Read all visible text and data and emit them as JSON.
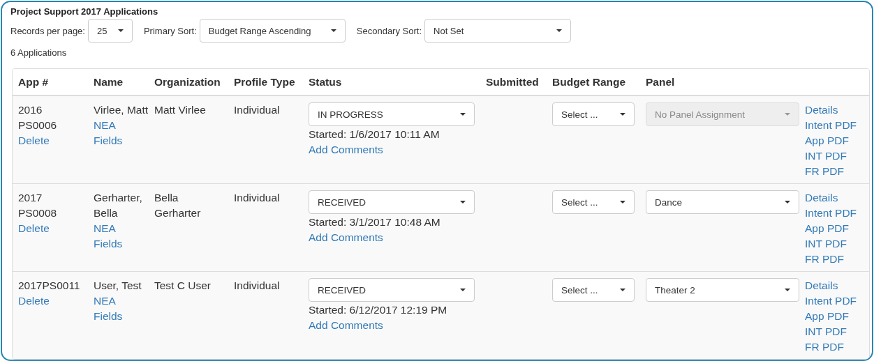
{
  "title": "Project Support 2017 Applications",
  "controls": [
    {
      "label": "Records per page:",
      "value": "25",
      "kind": "small"
    },
    {
      "label": "Primary Sort:",
      "value": "Budget Range Ascending",
      "kind": "medium"
    },
    {
      "label": "Secondary Sort:",
      "value": "Not Set",
      "kind": "large"
    }
  ],
  "count": "6 Applications",
  "table": {
    "columns": [
      "App #",
      "Name",
      "Organization",
      "Profile Type",
      "Status",
      "Submitted",
      "Budget Range",
      "Panel"
    ],
    "rows": [
      {
        "app_number": "2016 PS0006",
        "delete": "Delete",
        "name": "Virlee, Matt",
        "nea_fields": "NEA Fields",
        "organization": "Matt Virlee",
        "profile_type": "Individual",
        "status": "IN PROGRESS",
        "started": "Started: 1/6/2017 10:11 AM",
        "add_comments": "Add Comments",
        "budget_range": "Select ...",
        "panel": "No Panel Assignment",
        "panel_disabled": true,
        "links": [
          "Details",
          "Intent PDF",
          "App PDF",
          "INT PDF",
          "FR PDF"
        ]
      },
      {
        "app_number": "2017 PS0008",
        "delete": "Delete",
        "name": "Gerharter, Bella",
        "nea_fields": "NEA Fields",
        "organization": "Bella Gerharter",
        "profile_type": "Individual",
        "status": "RECEIVED",
        "started": "Started: 3/1/2017 10:48 AM",
        "add_comments": "Add Comments",
        "budget_range": "Select ...",
        "panel": "Dance",
        "panel_disabled": false,
        "links": [
          "Details",
          "Intent PDF",
          "App PDF",
          "INT PDF",
          "FR PDF"
        ]
      },
      {
        "app_number": "2017PS0011",
        "delete": "Delete",
        "name": "User, Test",
        "nea_fields": "NEA Fields",
        "organization": "Test C User",
        "profile_type": "Individual",
        "status": "RECEIVED",
        "started": "Started: 6/12/2017 12:19 PM",
        "add_comments": "Add Comments",
        "budget_range": "Select ...",
        "panel": "Theater 2",
        "panel_disabled": false,
        "links": [
          "Details",
          "Intent PDF",
          "App PDF",
          "INT PDF",
          "FR PDF"
        ]
      }
    ]
  }
}
